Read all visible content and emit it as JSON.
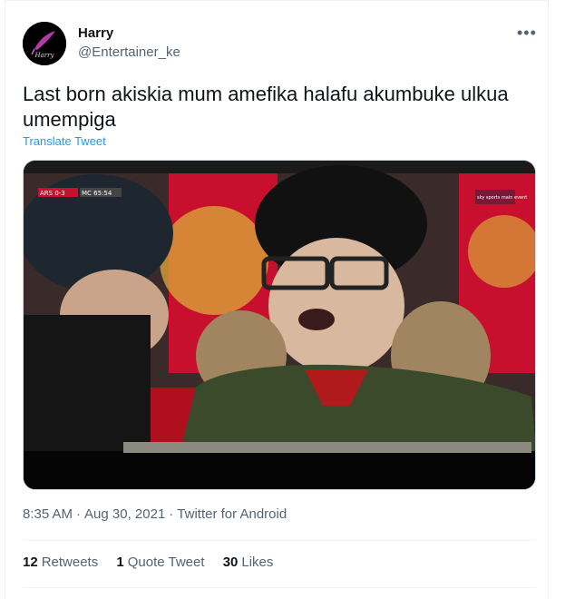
{
  "author": {
    "name": "Harry",
    "handle": "@Entertainer_ke",
    "avatar_logo_text": "Harry",
    "avatar_icon": "feather-quill-icon"
  },
  "more_icon": "more-options-icon",
  "tweet": {
    "text": "Last born akiskia mum amefika halafu akumbuke ulkua umempiga",
    "translate_label": "Translate Tweet"
  },
  "media": {
    "scoreboard_left": "ARS 0-3",
    "scoreboard_right": "MC 65:54",
    "broadcaster_logo": "sky sports main event"
  },
  "meta": {
    "time": "8:35 AM",
    "date": "Aug 30, 2021",
    "source": "Twitter for Android"
  },
  "stats": {
    "retweets_count": "12",
    "retweets_label": "Retweets",
    "quotes_count": "1",
    "quotes_label": "Quote Tweet",
    "likes_count": "30",
    "likes_label": "Likes"
  },
  "colors": {
    "link_blue": "#1d9bf0",
    "secondary_text": "#536471",
    "border": "#eff3f4"
  }
}
